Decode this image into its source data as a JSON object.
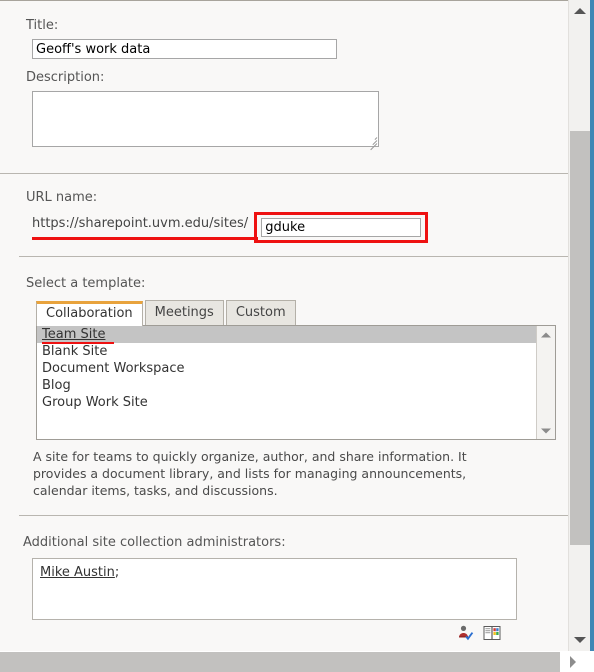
{
  "form": {
    "title": {
      "label": "Title:",
      "value": "Geoff's work data",
      "placeholder": ""
    },
    "description": {
      "label": "Description:",
      "value": "",
      "placeholder": ""
    },
    "url": {
      "label": "URL name:",
      "prefix": "https://sharepoint.uvm.edu/sites/",
      "value": "gduke",
      "placeholder": "",
      "highlight_color": "#ee1111"
    },
    "template": {
      "label": "Select a template:",
      "tabs": [
        {
          "label": "Collaboration",
          "active": true
        },
        {
          "label": "Meetings",
          "active": false
        },
        {
          "label": "Custom",
          "active": false
        }
      ],
      "active_tab_accent": "#e8a33d",
      "options": [
        {
          "label": "Team Site",
          "selected": true
        },
        {
          "label": "Blank Site",
          "selected": false
        },
        {
          "label": "Document Workspace",
          "selected": false
        },
        {
          "label": "Blog",
          "selected": false
        },
        {
          "label": "Group Work Site",
          "selected": false
        }
      ],
      "description": "A site for teams to quickly organize, author, and share information. It provides a document library, and lists for managing announcements, calendar items, tasks, and discussions.",
      "scroll_up_icon": "triangle-up-icon",
      "scroll_down_icon": "triangle-down-icon"
    },
    "administrators": {
      "label": "Additional site collection administrators:",
      "value": "Mike Austin",
      "separator": ";",
      "check_names_icon": "check-names-icon",
      "address_book_icon": "address-book-icon"
    }
  },
  "scrollbars": {
    "vertical": {
      "up_icon": "scroll-up-arrow-icon",
      "down_icon": "scroll-down-arrow-icon"
    },
    "horizontal": {
      "right_icon": "scroll-right-arrow-icon"
    }
  }
}
